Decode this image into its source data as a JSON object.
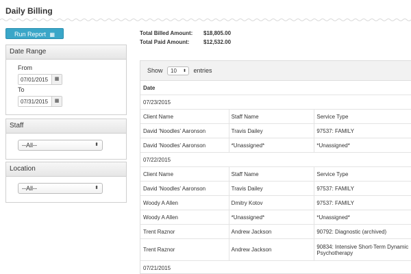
{
  "page": {
    "title": "Daily Billing"
  },
  "toolbar": {
    "run_report_label": "Run Report",
    "run_report_icon": "calendar-icon"
  },
  "filters": {
    "date_range": {
      "title": "Date Range",
      "from_label": "From",
      "from_value": "07/01/2015",
      "to_label": "To",
      "to_value": "07/31/2015",
      "picker_icon": "calendar-icon"
    },
    "staff": {
      "title": "Staff",
      "selected": "--All--"
    },
    "location": {
      "title": "Location",
      "selected": "--All--"
    }
  },
  "summary": {
    "total_billed_label": "Total Billed Amount:",
    "total_billed_value": "$18,805.00",
    "total_paid_label": "Total Paid Amount:",
    "total_paid_value": "$12,532.00"
  },
  "table": {
    "show_label": "Show",
    "page_size": "10",
    "entries_label": "entries",
    "date_header": "Date",
    "columns": [
      "Client Name",
      "Staff Name",
      "Service Type"
    ],
    "groups": [
      {
        "date": "07/23/2015",
        "rows": [
          [
            "David 'Noodles' Aaronson",
            "Travis Dailey",
            "97537: FAMILY"
          ],
          [
            "David 'Noodles' Aaronson",
            "*Unassigned*",
            "*Unassigned*"
          ]
        ]
      },
      {
        "date": "07/22/2015",
        "rows": [
          [
            "David 'Noodles' Aaronson",
            "Travis Dailey",
            "97537: FAMILY"
          ],
          [
            "Woody A Allen",
            "Dmitry Kotov",
            "97537: FAMILY"
          ],
          [
            "Woody A Allen",
            "*Unassigned*",
            "*Unassigned*"
          ],
          [
            "Trent Raznor",
            "Andrew Jackson",
            "90792: Diagnostic (archived)"
          ],
          [
            "Trent Raznor",
            "Andrew Jackson",
            "90834: Intensive Short-Term Dynamic Psychotherapy"
          ]
        ]
      },
      {
        "date": "07/21/2015",
        "rows": []
      }
    ]
  }
}
